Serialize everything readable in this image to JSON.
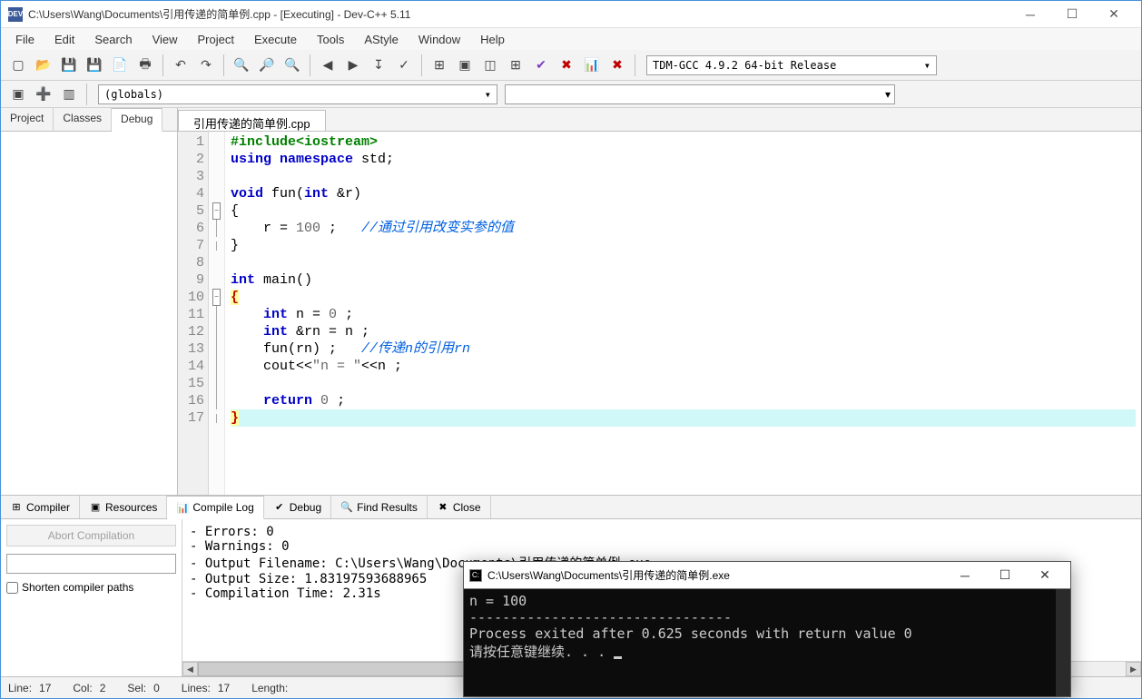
{
  "titlebar": {
    "icon_label": "DEV",
    "text": "C:\\Users\\Wang\\Documents\\引用传递的简单例.cpp - [Executing] - Dev-C++ 5.11"
  },
  "menus": [
    "File",
    "Edit",
    "Search",
    "View",
    "Project",
    "Execute",
    "Tools",
    "AStyle",
    "Window",
    "Help"
  ],
  "compiler_dropdown": "TDM-GCC 4.9.2 64-bit Release",
  "globals_dropdown": "(globals)",
  "left_tabs": [
    "Project",
    "Classes",
    "Debug"
  ],
  "left_active": "Debug",
  "file_tab": "引用传递的简单例.cpp",
  "code": {
    "lines": [
      {
        "n": 1,
        "html": "<span class='pre'>#include&lt;iostream&gt;</span>"
      },
      {
        "n": 2,
        "html": "<span class='kw'>using</span> <span class='kw'>namespace</span> std;"
      },
      {
        "n": 3,
        "html": ""
      },
      {
        "n": 4,
        "html": "<span class='kw'>void</span> fun(<span class='kw'>int</span> &amp;r)"
      },
      {
        "n": 5,
        "html": "{",
        "fold": "box"
      },
      {
        "n": 6,
        "html": "    r = <span class='str'>100</span> ;   <span class='cm'>//通过引用改变实参的值</span>",
        "fold": "line"
      },
      {
        "n": 7,
        "html": "}",
        "fold": "end"
      },
      {
        "n": 8,
        "html": ""
      },
      {
        "n": 9,
        "html": "<span class='kw'>int</span> main()"
      },
      {
        "n": 10,
        "html": "<span class='br br-hl'>{</span>",
        "fold": "box"
      },
      {
        "n": 11,
        "html": "    <span class='kw'>int</span> n = <span class='str'>0</span> ;",
        "fold": "line"
      },
      {
        "n": 12,
        "html": "    <span class='kw'>int</span> &amp;rn = n ;",
        "fold": "line"
      },
      {
        "n": 13,
        "html": "    fun(rn) ;   <span class='cm'>//传递n的引用rn</span>",
        "fold": "line"
      },
      {
        "n": 14,
        "html": "    cout&lt;&lt;<span class='str'>\"n = \"</span>&lt;&lt;n ;",
        "fold": "line"
      },
      {
        "n": 15,
        "html": "",
        "fold": "line"
      },
      {
        "n": 16,
        "html": "    <span class='kw'>return</span> <span class='str'>0</span> ;",
        "fold": "line"
      },
      {
        "n": 17,
        "html": "<span class='br br-hl'>}</span>",
        "fold": "end",
        "hl": true
      }
    ]
  },
  "bottom_tabs": [
    {
      "icon": "⊞",
      "label": "Compiler"
    },
    {
      "icon": "▣",
      "label": "Resources"
    },
    {
      "icon": "📊",
      "label": "Compile Log",
      "active": true
    },
    {
      "icon": "✔",
      "label": "Debug"
    },
    {
      "icon": "🔍",
      "label": "Find Results"
    },
    {
      "icon": "✖",
      "label": "Close"
    }
  ],
  "abort_btn": "Abort Compilation",
  "shorten_chk": "Shorten compiler paths",
  "compile_log": "- Errors: 0\n- Warnings: 0\n- Output Filename: C:\\Users\\Wang\\Documents\\引用传递的简单例.exe\n- Output Size: 1.83197593688965\n- Compilation Time: 2.31s",
  "status": {
    "line_lbl": "Line:",
    "line": "17",
    "col_lbl": "Col:",
    "col": "2",
    "sel_lbl": "Sel:",
    "sel": "0",
    "lines_lbl": "Lines:",
    "lines": "17",
    "len_lbl": "Length:"
  },
  "console": {
    "title": "C:\\Users\\Wang\\Documents\\引用传递的简单例.exe",
    "body": "n = 100\n--------------------------------\nProcess exited after 0.625 seconds with return value 0\n请按任意键继续. . . "
  }
}
